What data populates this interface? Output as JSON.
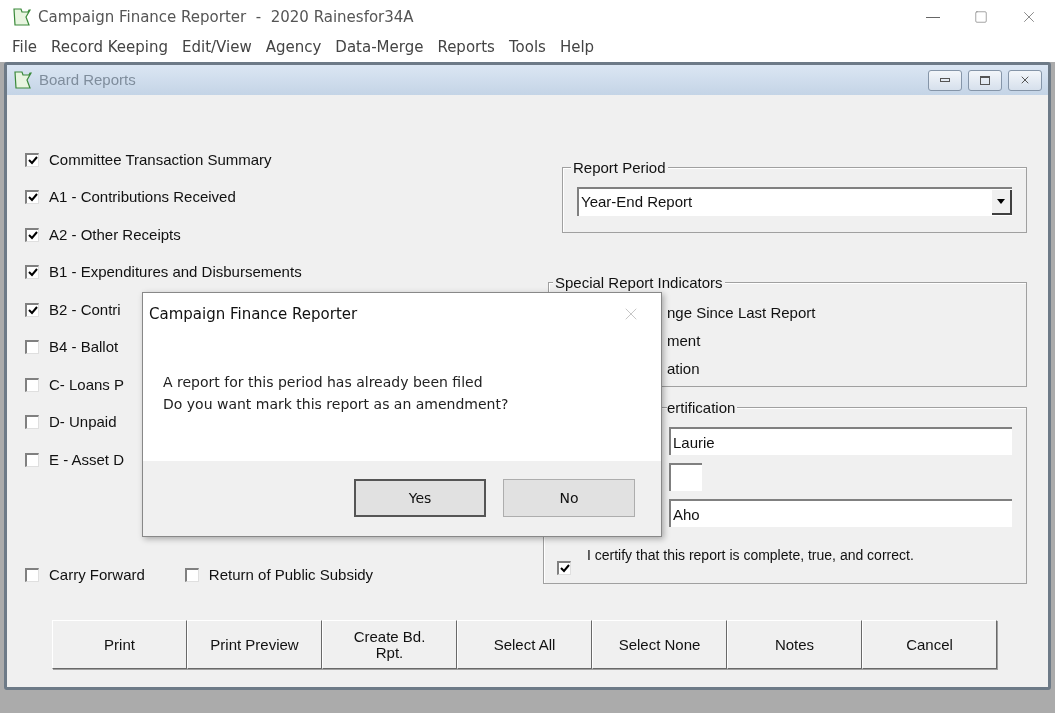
{
  "window": {
    "title": "Campaign Finance Reporter  -  2020 Rainesfor34A"
  },
  "menu": [
    "File",
    "Record Keeping",
    "Edit/View",
    "Agency",
    "Data-Merge",
    "Reports",
    "Tools",
    "Help"
  ],
  "child_window": {
    "title": "Board Reports"
  },
  "reports": [
    {
      "label": "Committee Transaction Summary",
      "checked": true
    },
    {
      "label": "A1 - Contributions Received",
      "checked": true
    },
    {
      "label": "A2 - Other Receipts",
      "checked": true
    },
    {
      "label": "B1 - Expenditures and Disbursements",
      "checked": true
    },
    {
      "label": "B2 - Contri",
      "checked": true
    },
    {
      "label": "B4 - Ballot",
      "checked": false
    },
    {
      "label": "C- Loans P",
      "checked": false
    },
    {
      "label": "D- Unpaid",
      "checked": false
    },
    {
      "label": "E - Asset D",
      "checked": false
    }
  ],
  "options": [
    {
      "label": "Carry Forward",
      "checked": false
    },
    {
      "label": "Return of Public Subsidy",
      "checked": false
    }
  ],
  "report_period": {
    "legend": "Report Period",
    "value": "Year-End Report"
  },
  "special_indicators": {
    "legend": "Special Report Indicators",
    "items": [
      "nge Since Last Report",
      "ment",
      "ation"
    ]
  },
  "certification": {
    "legend": "ertification",
    "fields": [
      {
        "value": "Laurie",
        "kind": "wide"
      },
      {
        "kind": "narrow"
      },
      {
        "value": "Aho",
        "kind": "wide"
      }
    ],
    "certify": {
      "label": "I certify that this report is complete, true, and correct.",
      "checked": true
    }
  },
  "buttons": [
    "Print",
    "Print Preview",
    "Create Bd. Rpt.",
    "Select All",
    "Select None",
    "Notes",
    "Cancel"
  ],
  "dialog": {
    "title": "Campaign Finance Reporter",
    "message": [
      "A report for this period has already been filed",
      "Do you want mark this report as an amendment?"
    ],
    "buttons": [
      "Yes",
      "No"
    ]
  }
}
